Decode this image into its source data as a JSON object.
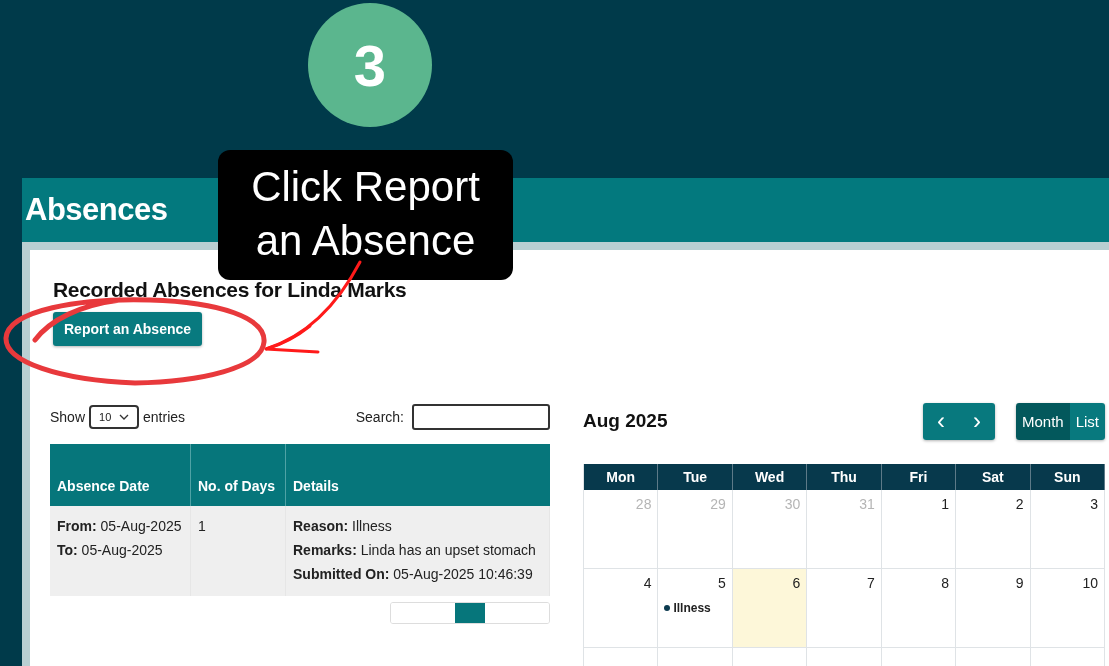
{
  "step_badge": {
    "number": "3"
  },
  "callout": {
    "text": "Click Report an Absence"
  },
  "header": {
    "title": "Absences"
  },
  "card": {
    "title": "Recorded Absences for Linda Marks",
    "report_button": "Report an Absence"
  },
  "table_controls": {
    "show_label": "Show",
    "page_size": "10",
    "entries_label": "entries",
    "search_label": "Search:"
  },
  "table": {
    "columns": [
      "Absence Date",
      "No. of Days",
      "Details"
    ],
    "rows": [
      {
        "absence_date": [
          "**From:** 05-Aug-2025",
          "**To:** 05-Aug-2025"
        ],
        "days": "1",
        "details": [
          "**Reason:** Illness",
          "**Remarks:** Linda has an upset stomach",
          "**Submitted On:** 05-Aug-2025 10:46:39"
        ]
      }
    ]
  },
  "calendar": {
    "title": "Aug 2025",
    "prev": "‹",
    "next": "›",
    "views": [
      {
        "label": "Month",
        "selected": true
      },
      {
        "label": "List",
        "selected": false
      }
    ],
    "weekdays": [
      "Mon",
      "Tue",
      "Wed",
      "Thu",
      "Fri",
      "Sat",
      "Sun"
    ],
    "weeks": [
      [
        {
          "label": "28",
          "muted": true,
          "today": false
        },
        {
          "label": "29",
          "muted": true,
          "today": false
        },
        {
          "label": "30",
          "muted": true,
          "today": false
        },
        {
          "label": "31",
          "muted": true,
          "today": false
        },
        {
          "label": "1",
          "muted": false,
          "today": false
        },
        {
          "label": "2",
          "muted": false,
          "today": false
        },
        {
          "label": "3",
          "muted": false,
          "today": false
        }
      ],
      [
        {
          "label": "4",
          "muted": false,
          "today": false
        },
        {
          "label": "5",
          "muted": false,
          "today": false,
          "events": [
            {
              "label": "Illness",
              "color": "#0b3a4f"
            }
          ]
        },
        {
          "label": "6",
          "muted": false,
          "today": true
        },
        {
          "label": "7",
          "muted": false,
          "today": false
        },
        {
          "label": "8",
          "muted": false,
          "today": false
        },
        {
          "label": "9",
          "muted": false,
          "today": false
        },
        {
          "label": "10",
          "muted": false,
          "today": false
        }
      ]
    ]
  }
}
